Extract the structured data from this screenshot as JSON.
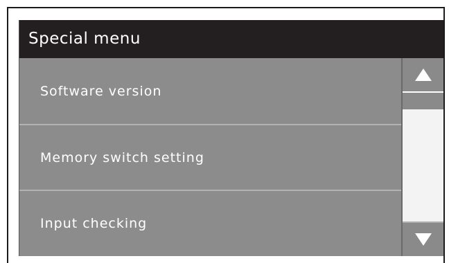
{
  "screen": {
    "title": "Special menu"
  },
  "menu": {
    "items": [
      {
        "label": "Software version"
      },
      {
        "label": "Memory switch setting"
      },
      {
        "label": "Input checking"
      }
    ]
  },
  "scroll": {
    "up_icon": "triangle-up-icon",
    "down_icon": "triangle-down-icon"
  },
  "colors": {
    "title_bar": "#231f20",
    "menu_background": "#8c8c8c",
    "text": "#ffffff"
  }
}
